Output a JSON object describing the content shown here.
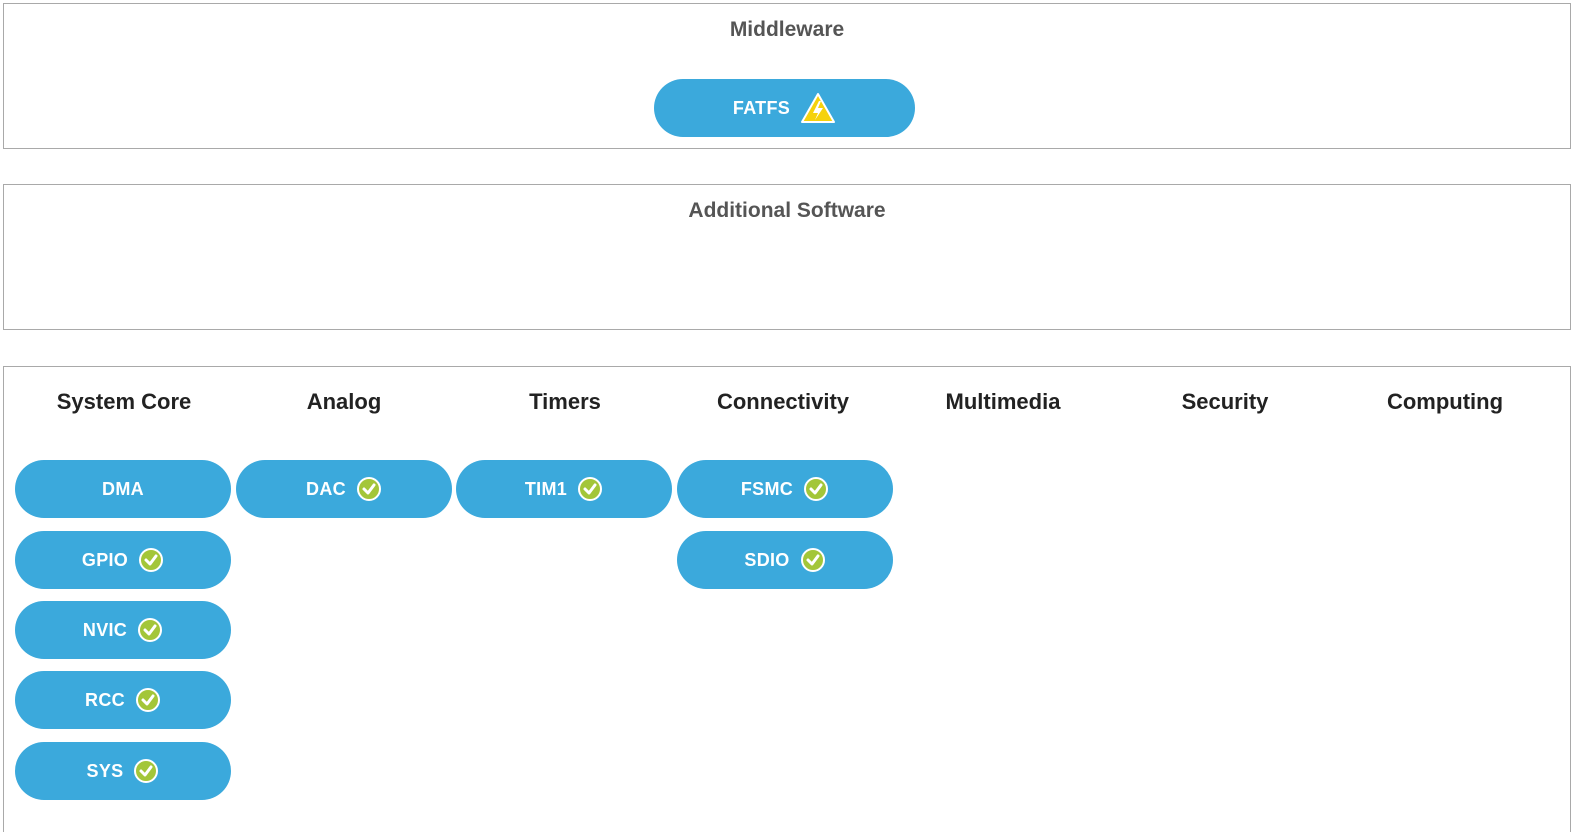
{
  "middleware": {
    "title": "Middleware",
    "items": [
      {
        "label": "FATFS",
        "status": "warning"
      }
    ]
  },
  "additional_software": {
    "title": "Additional Software",
    "items": []
  },
  "categories": {
    "columns": [
      {
        "title": "System Core",
        "items": [
          {
            "label": "DMA",
            "status": "none"
          },
          {
            "label": "GPIO",
            "status": "ok"
          },
          {
            "label": "NVIC",
            "status": "ok"
          },
          {
            "label": "RCC",
            "status": "ok"
          },
          {
            "label": "SYS",
            "status": "ok"
          }
        ]
      },
      {
        "title": "Analog",
        "items": [
          {
            "label": "DAC",
            "status": "ok"
          }
        ]
      },
      {
        "title": "Timers",
        "items": [
          {
            "label": "TIM1",
            "status": "ok"
          }
        ]
      },
      {
        "title": "Connectivity",
        "items": [
          {
            "label": "FSMC",
            "status": "ok"
          },
          {
            "label": "SDIO",
            "status": "ok"
          }
        ]
      },
      {
        "title": "Multimedia",
        "items": []
      },
      {
        "title": "Security",
        "items": []
      },
      {
        "title": "Computing",
        "items": []
      }
    ]
  },
  "colors": {
    "pill": "#3ba9dc",
    "check": "#a3c639",
    "warning": "#f5d20c"
  }
}
